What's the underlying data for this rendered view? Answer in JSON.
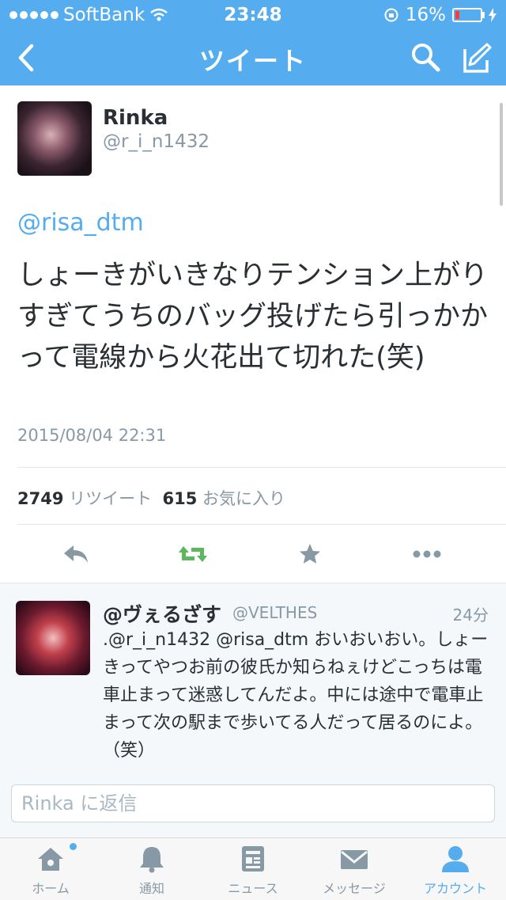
{
  "status_bar": {
    "carrier": "SoftBank",
    "time": "23:48",
    "battery": "16%"
  },
  "nav": {
    "title": "ツイート",
    "icons": [
      "back-icon",
      "search-icon",
      "compose-icon"
    ]
  },
  "tweet": {
    "name": "Rinka",
    "handle": "@r_i_n1432",
    "mention": "@risa_dtm",
    "text": "しょーきがいきなりテンション上がりすぎてうちのバッグ投げたら引っかかって電線から火花出て切れた(笑)",
    "timestamp": "2015/08/04 22:31",
    "retweet_count": "2749",
    "retweet_label": "リツイート",
    "fav_count": "615",
    "fav_label": "お気に入り",
    "actions": [
      "reply-icon",
      "retweet-icon",
      "favorite-icon",
      "more-icon"
    ],
    "colors": {
      "retweet_active": "#5db75d",
      "action_gray": "#8899a6"
    }
  },
  "reply": {
    "name": "@ヴぇるざす",
    "handle": "@VELTHES",
    "time": "24分",
    "text": ".@r_i_n1432 @risa_dtm おいおいおい。しょーきってやつお前の彼氏か知らねぇけどこっちは電車止まって迷惑してんだよ。中には途中で電車止まって次の駅まで歩いてる人だって居るのによ。（笑）"
  },
  "reply_box": {
    "placeholder": "Rinka に返信"
  },
  "tab_bar": {
    "tabs": [
      {
        "label": "ホーム",
        "icon": "home-icon"
      },
      {
        "label": "通知",
        "icon": "bell-icon"
      },
      {
        "label": "ニュース",
        "icon": "news-icon"
      },
      {
        "label": "メッセージ",
        "icon": "envelope-icon"
      },
      {
        "label": "アカウント",
        "icon": "person-icon"
      }
    ],
    "active_index": 4
  },
  "colors": {
    "brand": "#55acee",
    "text": "#292f33",
    "muted": "#8899a6"
  }
}
